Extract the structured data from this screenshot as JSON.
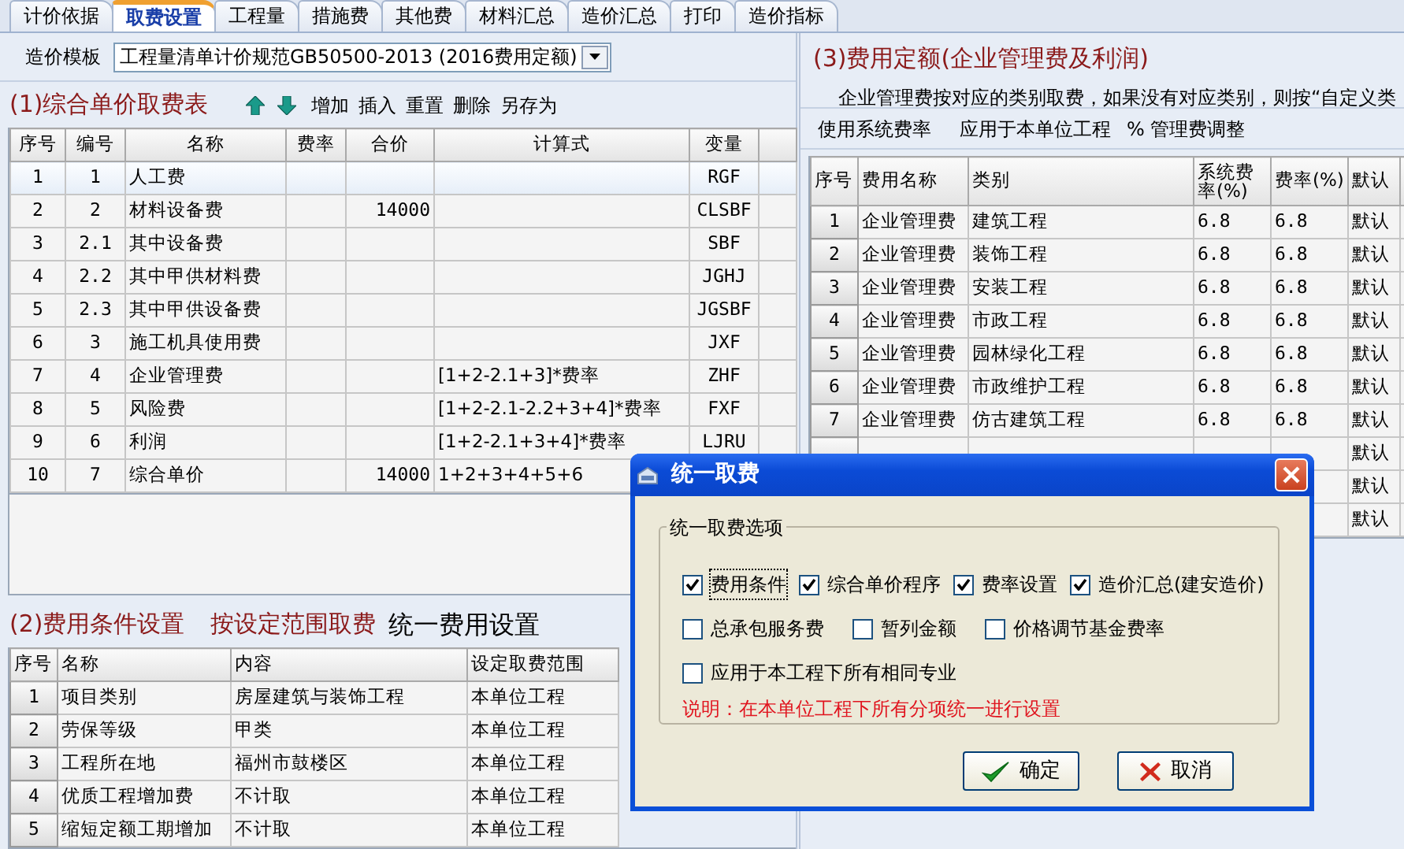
{
  "tabs": [
    {
      "label": "计价依据",
      "selected": false
    },
    {
      "label": "取费设置",
      "selected": true
    },
    {
      "label": "工程量",
      "selected": false
    },
    {
      "label": "措施费",
      "selected": false
    },
    {
      "label": "其他费",
      "selected": false
    },
    {
      "label": "材料汇总",
      "selected": false
    },
    {
      "label": "造价汇总",
      "selected": false
    },
    {
      "label": "打印",
      "selected": false
    },
    {
      "label": "造价指标",
      "selected": false
    }
  ],
  "template": {
    "label": "造价模板",
    "value": "工程量清单计价规范GB50500-2013 (2016费用定额)"
  },
  "fee_table": {
    "title": "(1)综合单价取费表",
    "toolbar": [
      "增加",
      "插入",
      "重置",
      "删除",
      "另存为"
    ],
    "columns": [
      "序号",
      "编号",
      "名称",
      "费率",
      "合价",
      "计算式",
      "变量"
    ],
    "rows": [
      {
        "selected": true,
        "no": "1",
        "code": "1",
        "name": "人工费",
        "var": "RGF"
      },
      {
        "selected": false,
        "no": "2",
        "code": "2",
        "name": "材料设备费",
        "total": "14000",
        "var": "CLSBF"
      },
      {
        "selected": false,
        "no": "3",
        "code": "2.1",
        "name": "其中设备费",
        "var": "SBF"
      },
      {
        "selected": false,
        "no": "4",
        "code": "2.2",
        "name": "其中甲供材料费",
        "var": "JGHJ"
      },
      {
        "selected": false,
        "no": "5",
        "code": "2.3",
        "name": "其中甲供设备费",
        "var": "JGSBF"
      },
      {
        "selected": false,
        "no": "6",
        "code": "3",
        "name": "施工机具使用费",
        "var": "JXF"
      },
      {
        "selected": false,
        "no": "7",
        "code": "4",
        "name": "企业管理费",
        "formula": "[1+2-2.1+3]*费率",
        "var": "ZHF"
      },
      {
        "selected": false,
        "no": "8",
        "code": "5",
        "name": "风险费",
        "formula": "[1+2-2.1-2.2+3+4]*费率",
        "var": "FXF"
      },
      {
        "selected": false,
        "no": "9",
        "code": "6",
        "name": "利润",
        "formula": "[1+2-2.1+3+4]*费率",
        "var": "LJRU"
      },
      {
        "selected": false,
        "no": "10",
        "code": "7",
        "name": "综合单价",
        "total": "14000",
        "formula": "1+2+3+4+5+6"
      }
    ]
  },
  "conditions": {
    "title": "(2)费用条件设置",
    "link": "按设定范围取费",
    "action": "统一费用设置",
    "columns": [
      "序号",
      "名称",
      "内容",
      "设定取费范围"
    ],
    "rows": [
      {
        "no": "1",
        "name": "项目类别",
        "content": "房屋建筑与装饰工程",
        "scope": "本单位工程"
      },
      {
        "no": "2",
        "name": "劳保等级",
        "content": "甲类",
        "scope": "本单位工程"
      },
      {
        "no": "3",
        "name": "工程所在地",
        "content": "福州市鼓楼区",
        "scope": "本单位工程"
      },
      {
        "no": "4",
        "name": "优质工程增加费",
        "content": "不计取",
        "scope": "本单位工程"
      },
      {
        "no": "5",
        "name": "缩短定额工期增加",
        "content": "不计取",
        "scope": "本单位工程"
      }
    ]
  },
  "quota": {
    "title": "(3)费用定额(企业管理费及利润)",
    "note": "企业管理费按对应的类别取费，如果没有对应类别，则按“自定义类",
    "toolbar": [
      "使用系统费率",
      "应用于本单位工程",
      "% 管理费调整"
    ],
    "columns": [
      "序号",
      "费用名称",
      "类别",
      "系统费率(%)",
      "费率(%)",
      "默认"
    ],
    "rows": [
      {
        "no": "1",
        "fee": "企业管理费",
        "category": "建筑工程",
        "sys_rate": "6.8",
        "rate": "6.8",
        "default": "默认"
      },
      {
        "no": "2",
        "fee": "企业管理费",
        "category": "装饰工程",
        "sys_rate": "6.8",
        "rate": "6.8",
        "default": "默认"
      },
      {
        "no": "3",
        "fee": "企业管理费",
        "category": "安装工程",
        "sys_rate": "6.8",
        "rate": "6.8",
        "default": "默认"
      },
      {
        "no": "4",
        "fee": "企业管理费",
        "category": "市政工程",
        "sys_rate": "6.8",
        "rate": "6.8",
        "default": "默认"
      },
      {
        "no": "5",
        "fee": "企业管理费",
        "category": "园林绿化工程",
        "sys_rate": "6.8",
        "rate": "6.8",
        "default": "默认"
      },
      {
        "no": "6",
        "fee": "企业管理费",
        "category": "市政维护工程",
        "sys_rate": "6.8",
        "rate": "6.8",
        "default": "默认"
      },
      {
        "no": "7",
        "fee": "企业管理费",
        "category": "仿古建筑工程",
        "sys_rate": "6.8",
        "rate": "6.8",
        "default": "默认"
      },
      {
        "default": "默认"
      },
      {
        "default": "默认"
      },
      {
        "default": "默认"
      }
    ]
  },
  "dialog": {
    "title": "统一取费",
    "group": "统一取费选项",
    "options": [
      [
        {
          "label": "费用条件",
          "checked": true
        },
        {
          "label": "综合单价程序",
          "checked": true
        },
        {
          "label": "费率设置",
          "checked": true
        },
        {
          "label": "造价汇总(建安造价)",
          "checked": true
        }
      ],
      [
        {
          "label": "总承包服务费",
          "checked": false
        },
        {
          "label": "暂列金额",
          "checked": false
        },
        {
          "label": "价格调节基金费率",
          "checked": false
        }
      ],
      [
        {
          "label": "应用于本工程下所有相同专业",
          "checked": false
        }
      ]
    ],
    "note": "说明：在本单位工程下所有分项统一进行设置",
    "buttons": [
      {
        "kind": "ok",
        "label": "确定"
      },
      {
        "kind": "cancel",
        "label": "取消"
      }
    ]
  }
}
